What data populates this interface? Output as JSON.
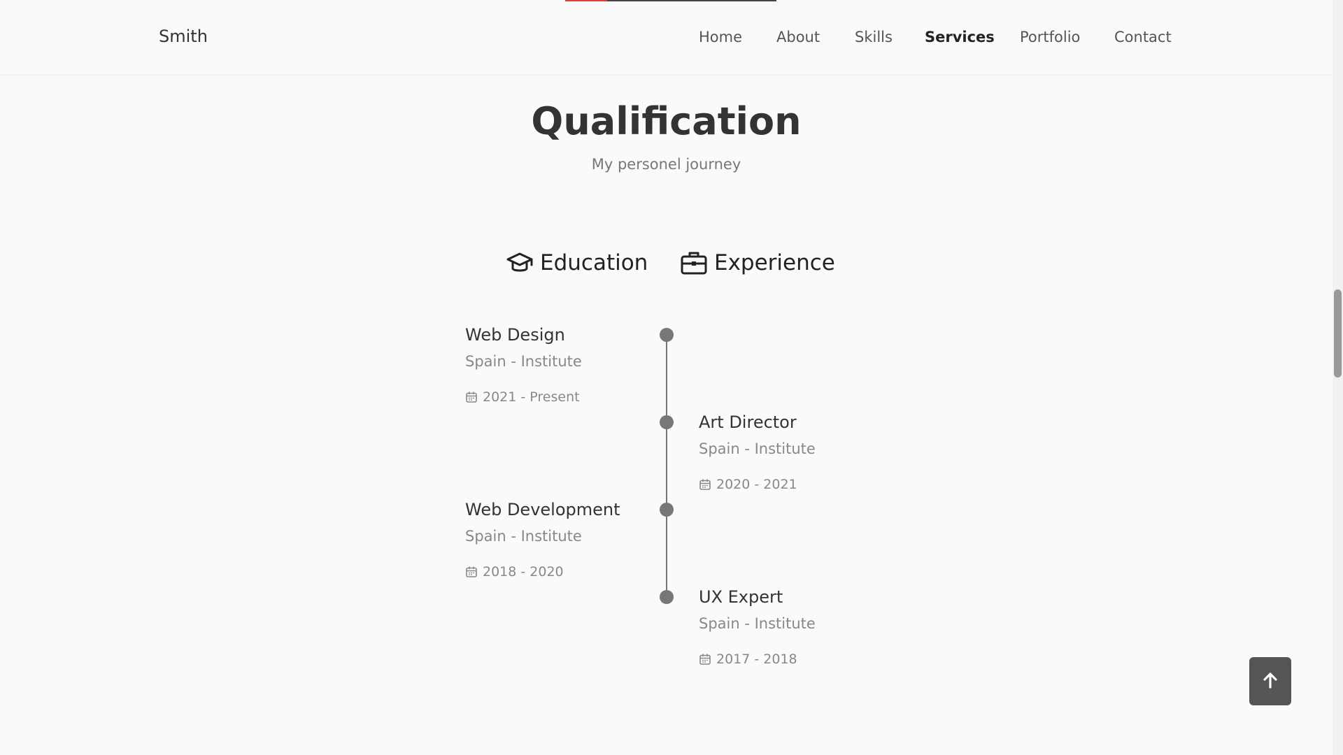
{
  "header": {
    "logo": "Smith",
    "progress_percent": 20,
    "nav": [
      {
        "label": "Home"
      },
      {
        "label": "About"
      },
      {
        "label": "Skills"
      },
      {
        "label": "Services",
        "active": true
      },
      {
        "label": "Portfolio"
      },
      {
        "label": "Contact"
      }
    ]
  },
  "qualification": {
    "title": "Qualification",
    "subtitle": "My personel journey",
    "tabs": [
      {
        "label": "Education",
        "icon": "graduation-cap-icon"
      },
      {
        "label": "Experience",
        "icon": "briefcase-icon"
      }
    ],
    "items": [
      {
        "title": "Web Design",
        "subtitle": "Spain - Institute",
        "date": "2021 - Present",
        "side": "left"
      },
      {
        "title": "Art Director",
        "subtitle": "Spain - Institute",
        "date": "2020 - 2021",
        "side": "right"
      },
      {
        "title": "Web Development",
        "subtitle": "Spain - Institute",
        "date": "2018 - 2020",
        "side": "left"
      },
      {
        "title": "UX Expert",
        "subtitle": "Spain - Institute",
        "date": "2017 - 2018",
        "side": "right"
      }
    ]
  },
  "scroll_top": {
    "icon": "arrow-up-icon"
  },
  "colors": {
    "accent": "#e53935",
    "text": "#333333",
    "muted": "#888888",
    "button": "#555555"
  }
}
